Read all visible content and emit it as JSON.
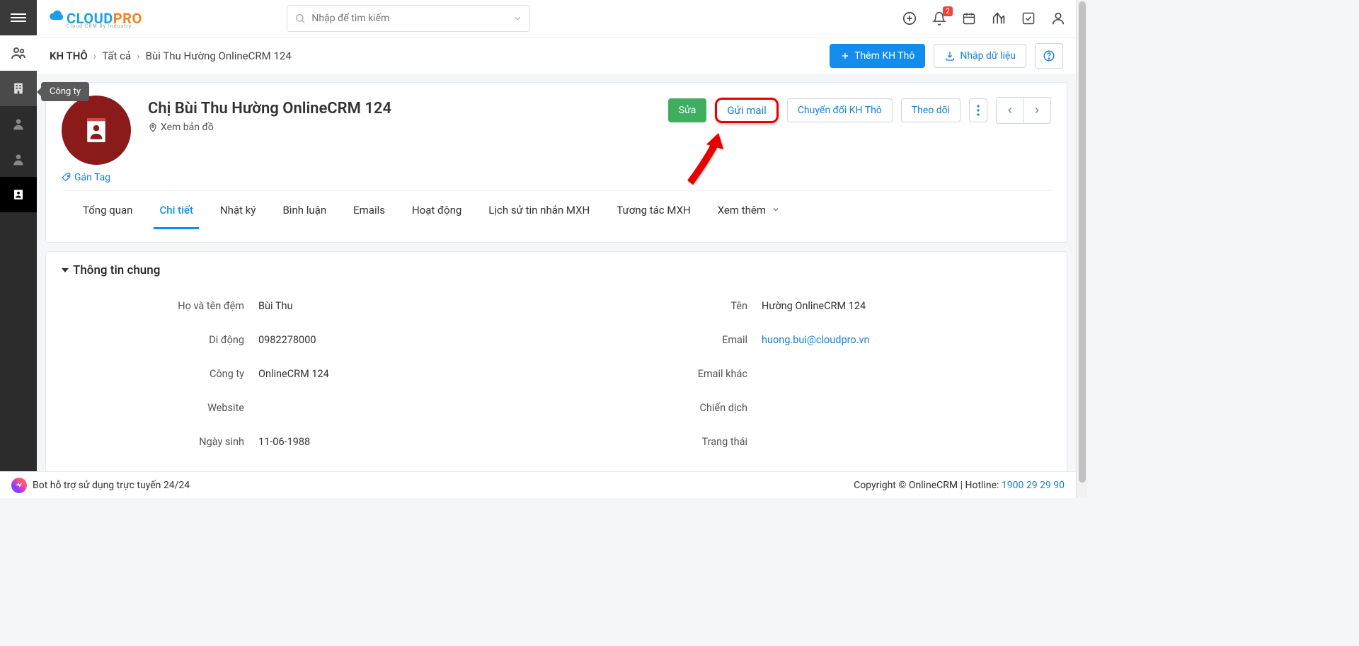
{
  "logo": {
    "part1": "CLOUD",
    "part2": "PRO",
    "tagline": "Cloud CRM By Industry"
  },
  "search": {
    "placeholder": "Nhập để tìm kiếm"
  },
  "tooltip": "Công ty",
  "notifications_count": "2",
  "breadcrumb": {
    "root": "KH THÔ",
    "mid": "Tất cả",
    "leaf": "Bùi Thu Hường OnlineCRM 124"
  },
  "header_buttons": {
    "add": "Thêm KH Thô",
    "import": "Nhập dữ liệu"
  },
  "record": {
    "title": "Chị Bùi Thu Hường OnlineCRM 124",
    "view_map": "Xem bản đồ",
    "tag": "Gán Tag"
  },
  "actions": {
    "edit": "Sửa",
    "send_mail": "Gửi mail",
    "convert": "Chuyển đổi KH Thô",
    "follow": "Theo dõi"
  },
  "tabs": [
    {
      "label": "Tổng quan",
      "key": "overview",
      "active": false
    },
    {
      "label": "Chi tiết",
      "key": "detail",
      "active": true
    },
    {
      "label": "Nhật ký",
      "key": "log",
      "active": false
    },
    {
      "label": "Bình luận",
      "key": "comment",
      "active": false
    },
    {
      "label": "Emails",
      "key": "emails",
      "active": false
    },
    {
      "label": "Hoạt động",
      "key": "activity",
      "active": false
    },
    {
      "label": "Lịch sử tin nhắn MXH",
      "key": "smshist",
      "active": false
    },
    {
      "label": "Tương tác MXH",
      "key": "social",
      "active": false
    },
    {
      "label": "Xem thêm",
      "key": "more",
      "active": false
    }
  ],
  "section_title": "Thông tin chung",
  "details": {
    "last_first_label": "Họ và tên đệm",
    "last_first_value": "Bùi Thu",
    "name_label": "Tên",
    "name_value": "Hường OnlineCRM 124",
    "mobile_label": "Di động",
    "mobile_value": "0982278000",
    "email_label": "Email",
    "email_value": "huong.bui@cloudpro.vn",
    "company_label": "Công ty",
    "company_value": "OnlineCRM 124",
    "email2_label": "Email khác",
    "email2_value": "",
    "website_label": "Website",
    "website_value": "",
    "campaign_label": "Chiến dịch",
    "campaign_value": "",
    "dob_label": "Ngày sinh",
    "dob_value": "11-06-1988",
    "status_label": "Trạng thái",
    "status_value": ""
  },
  "footer": {
    "bot_text": "Bot hỗ trợ sử dụng trực tuyến 24/24",
    "copyright": "Copyright © OnlineCRM",
    "hotline_label": "Hotline:",
    "hotline_number": "1900 29 29 90"
  }
}
